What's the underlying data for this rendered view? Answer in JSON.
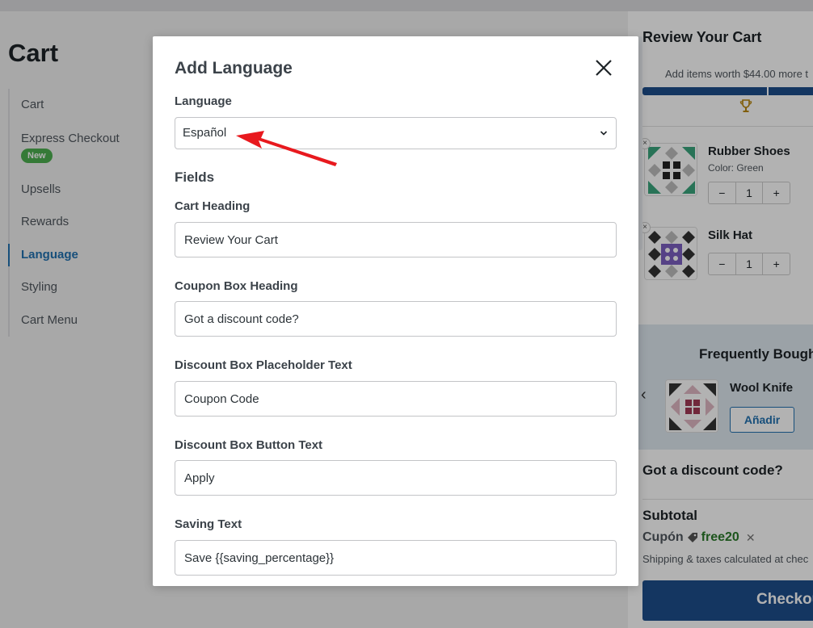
{
  "page": {
    "title": "Cart"
  },
  "side_nav": {
    "items": [
      {
        "label": "Cart"
      },
      {
        "label": "Express Checkout",
        "badge": "New"
      },
      {
        "label": "Upsells"
      },
      {
        "label": "Rewards"
      },
      {
        "label": "Language",
        "active": true
      },
      {
        "label": "Styling"
      },
      {
        "label": "Cart Menu"
      }
    ]
  },
  "modal": {
    "title": "Add Language",
    "close_icon": "close-icon",
    "language_label": "Language",
    "language_value": "Español",
    "fields_heading": "Fields",
    "fields": [
      {
        "label": "Cart Heading",
        "value": "Review Your Cart"
      },
      {
        "label": "Coupon Box Heading",
        "value": "Got a discount code?"
      },
      {
        "label": "Discount Box Placeholder Text",
        "value": "Coupon Code"
      },
      {
        "label": "Discount Box Button Text",
        "value": "Apply"
      },
      {
        "label": "Saving Text",
        "value": "Save {{saving_percentage}}"
      }
    ]
  },
  "preview": {
    "title": "Review Your Cart",
    "progress_text": "Add items worth $44.00 more t",
    "items": [
      {
        "name": "Rubber Shoes",
        "variant": "Color: Green",
        "qty": "1"
      },
      {
        "name": "Silk Hat",
        "variant": "",
        "qty": "1"
      }
    ],
    "frequently_bought": {
      "title": "Frequently Bough",
      "item": "Wool Knife",
      "add_label": "Añadir"
    },
    "coupon_heading": "Got a discount code?",
    "subtotal_label": "Subtotal",
    "coupon_label": "Cupón",
    "coupon_code": "free20",
    "shipping_text": "Shipping & taxes calculated at chec",
    "checkout_label": "Checkou"
  },
  "colors": {
    "accent": "#2271b1",
    "bar": "#1e4e8c",
    "badge_new": "#4caf50",
    "annotation_arrow": "#e8191e"
  }
}
